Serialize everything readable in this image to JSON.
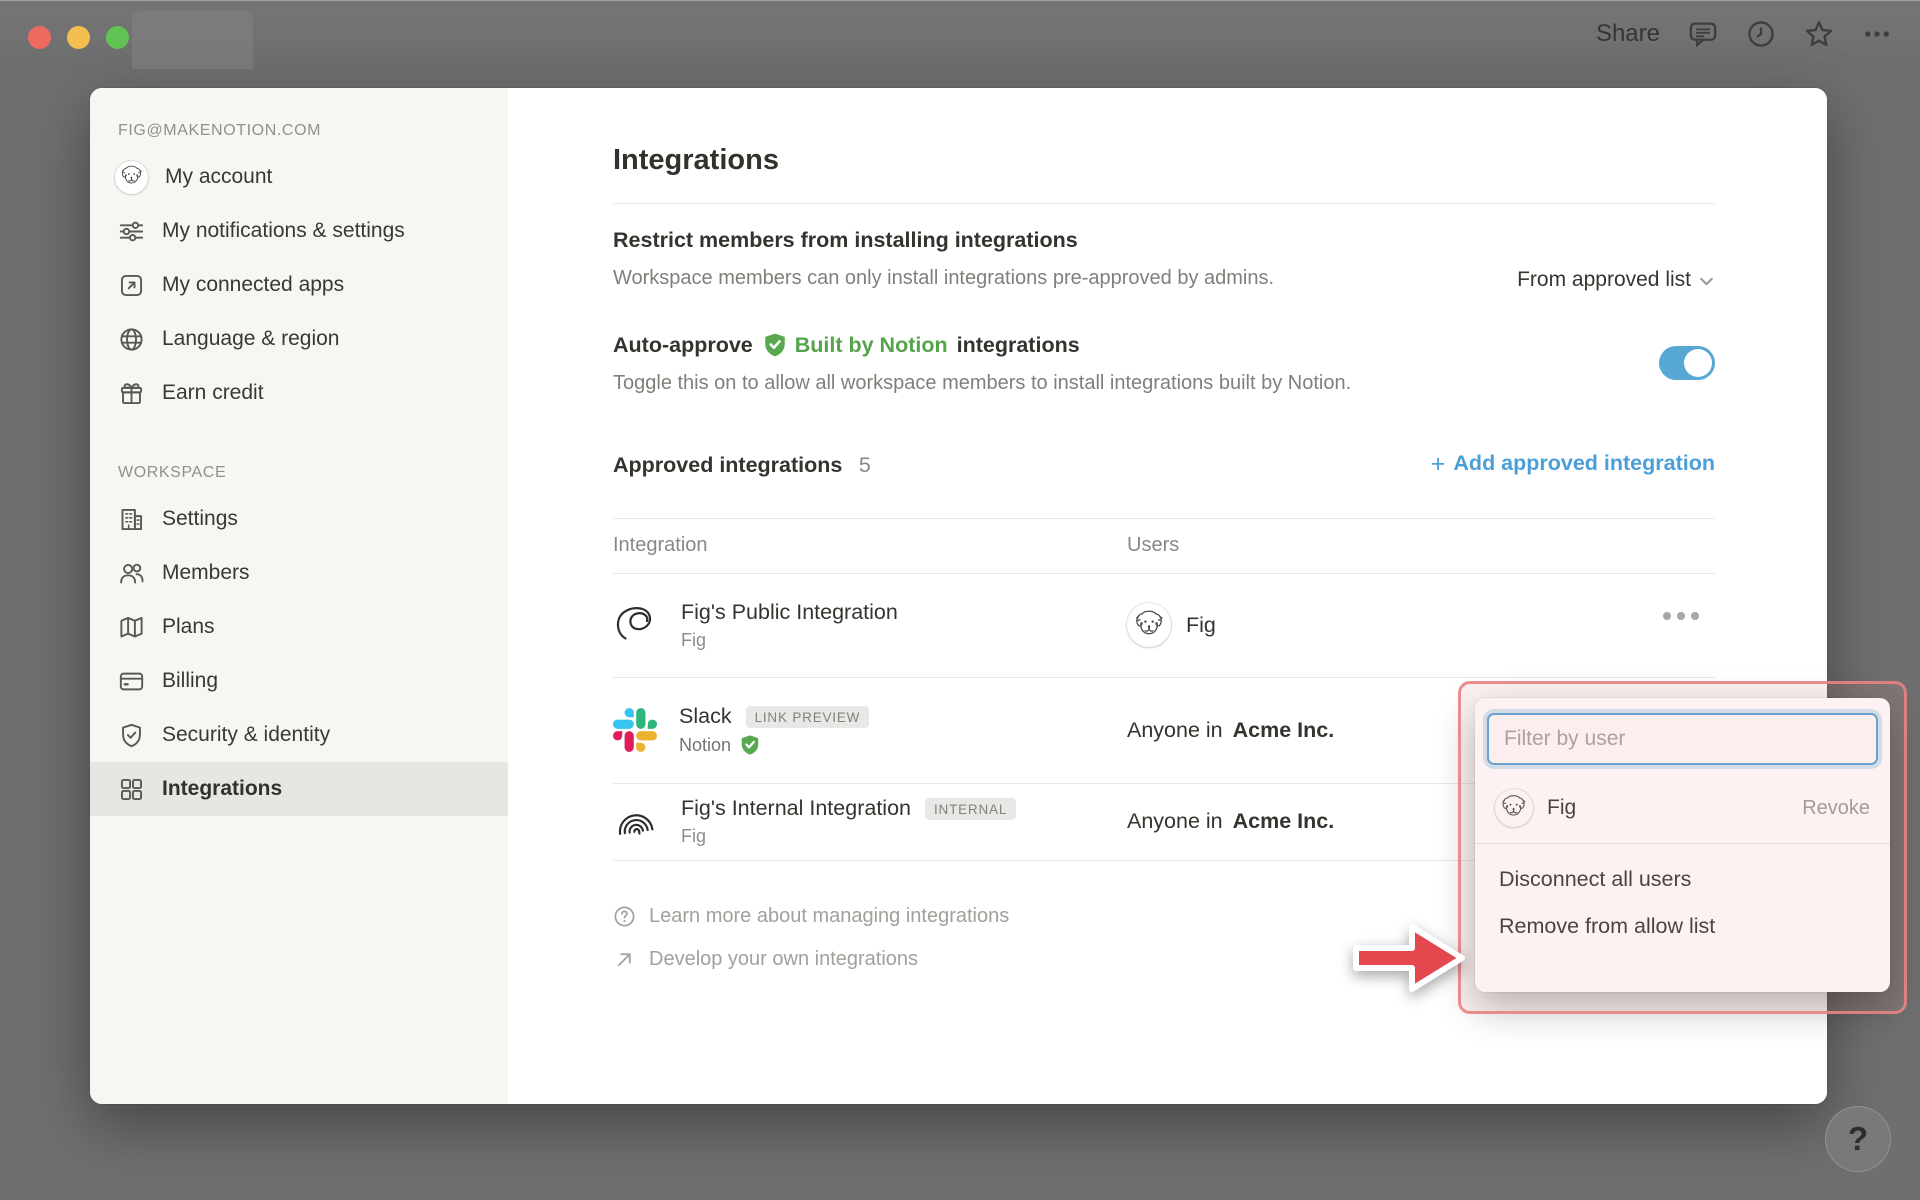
{
  "window": {
    "topbar": {
      "share_label": "Share"
    },
    "icons": [
      "comment-icon",
      "history-clock-icon",
      "star-icon",
      "ellipsis-icon"
    ]
  },
  "sidebar": {
    "account_header": "FIG@MAKENOTION.COM",
    "account_items": [
      {
        "icon": "user-avatar",
        "label": "My account"
      },
      {
        "icon": "sliders-icon",
        "label": "My notifications & settings"
      },
      {
        "icon": "arrow-up-right-box-icon",
        "label": "My connected apps"
      },
      {
        "icon": "globe-icon",
        "label": "Language & region"
      },
      {
        "icon": "gift-icon",
        "label": "Earn credit"
      }
    ],
    "workspace_header": "WORKSPACE",
    "workspace_items": [
      {
        "icon": "building-icon",
        "label": "Settings",
        "selected": false
      },
      {
        "icon": "people-icon",
        "label": "Members",
        "selected": false
      },
      {
        "icon": "map-icon",
        "label": "Plans",
        "selected": false
      },
      {
        "icon": "credit-card-icon",
        "label": "Billing",
        "selected": false
      },
      {
        "icon": "shield-check-icon",
        "label": "Security & identity",
        "selected": false
      },
      {
        "icon": "grid-icon",
        "label": "Integrations",
        "selected": true
      }
    ]
  },
  "main": {
    "title": "Integrations",
    "restrict": {
      "title": "Restrict members from installing integrations",
      "description": "Workspace members can only install integrations pre-approved by admins.",
      "dropdown_value": "From approved list"
    },
    "auto_approve": {
      "title_prefix": "Auto-approve",
      "badge_label": "Built by Notion",
      "title_suffix": "integrations",
      "description": "Toggle this on to allow all workspace members to install integrations built by Notion.",
      "toggle_state": "on"
    },
    "approved": {
      "title": "Approved integrations",
      "count": "5",
      "add_label": "Add approved integration"
    },
    "table": {
      "columns": [
        "Integration",
        "Users"
      ],
      "rows": [
        {
          "name": "Fig's Public Integration",
          "subtitle": "Fig",
          "icon": "scribble-doodle-icon",
          "user_name": "Fig"
        },
        {
          "name": "Slack",
          "badge": "LINK PREVIEW",
          "subtitle": "Notion",
          "icon": "slack-icon",
          "users_prefix": "Anyone in",
          "users_org": "Acme Inc."
        },
        {
          "name": "Fig's Internal Integration",
          "badge": "INTERNAL",
          "subtitle": "Fig",
          "icon": "arcs-doodle-icon",
          "users_prefix": "Anyone in",
          "users_org": "Acme Inc."
        }
      ]
    },
    "footer_links": [
      {
        "icon": "question-circle-icon",
        "label": "Learn more about managing integrations"
      },
      {
        "icon": "arrow-up-right-icon",
        "label": "Develop your own integrations"
      }
    ]
  },
  "popup": {
    "filter_placeholder": "Filter by user",
    "user_name": "Fig",
    "revoke_label": "Revoke",
    "menu_items": [
      "Disconnect all users",
      "Remove from allow list"
    ]
  },
  "help": {
    "label": "?"
  },
  "colors": {
    "backdrop": "#6f6f6f",
    "sidebar_bg": "#f7f6f3",
    "selected_bg": "#e8e6e3",
    "link_blue": "#4b9fd9",
    "toggle_blue": "#57a8d4",
    "notion_green": "#55a34a",
    "annotation_red": "#e98284",
    "arrow_red": "#e4474d",
    "traffic_red": "#ee6a5e",
    "traffic_yellow": "#f4bf4e",
    "traffic_green": "#61c354"
  }
}
